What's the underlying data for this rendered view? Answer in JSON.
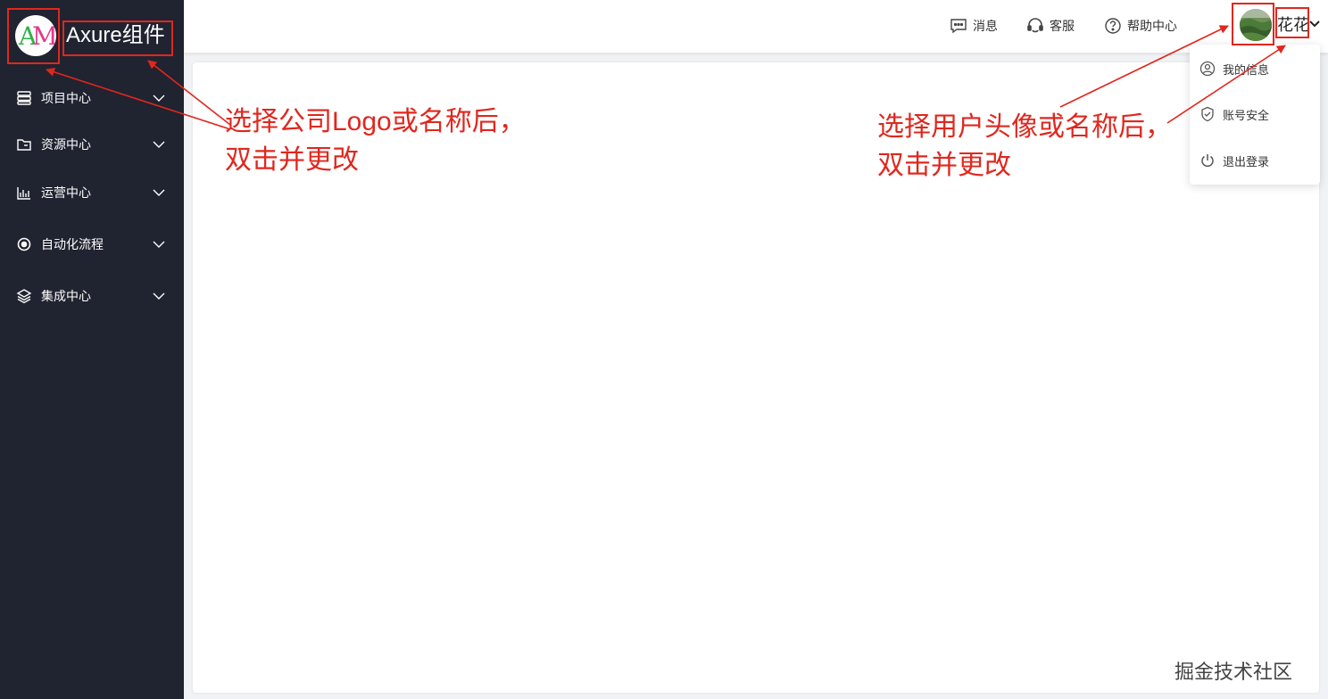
{
  "brand": {
    "logo_text": "AM",
    "name": "Axure组件"
  },
  "sidebar": {
    "items": [
      {
        "label": "项目中心",
        "icon": "server-icon"
      },
      {
        "label": "资源中心",
        "icon": "folder-icon"
      },
      {
        "label": "运营中心",
        "icon": "bar-chart-icon"
      },
      {
        "label": "自动化流程",
        "icon": "cycle-icon"
      },
      {
        "label": "集成中心",
        "icon": "layers-icon"
      }
    ]
  },
  "header": {
    "messages": "消息",
    "service": "客服",
    "help": "帮助中心",
    "username": "花花"
  },
  "user_menu": {
    "items": [
      {
        "label": "我的信息",
        "icon": "user-circle-icon"
      },
      {
        "label": "账号安全",
        "icon": "shield-check-icon"
      },
      {
        "label": "退出登录",
        "icon": "power-icon"
      }
    ]
  },
  "annotations": {
    "left_line1": "选择公司Logo或名称后，",
    "left_line2": "双击并更改",
    "right_line1": "选择用户头像或名称后，",
    "right_line2": "双击并更改"
  },
  "watermark": "掘金技术社区",
  "colors": {
    "sidebar_bg": "#202330",
    "annotation_red": "#e0271e",
    "page_bg": "#f0f2f5"
  }
}
